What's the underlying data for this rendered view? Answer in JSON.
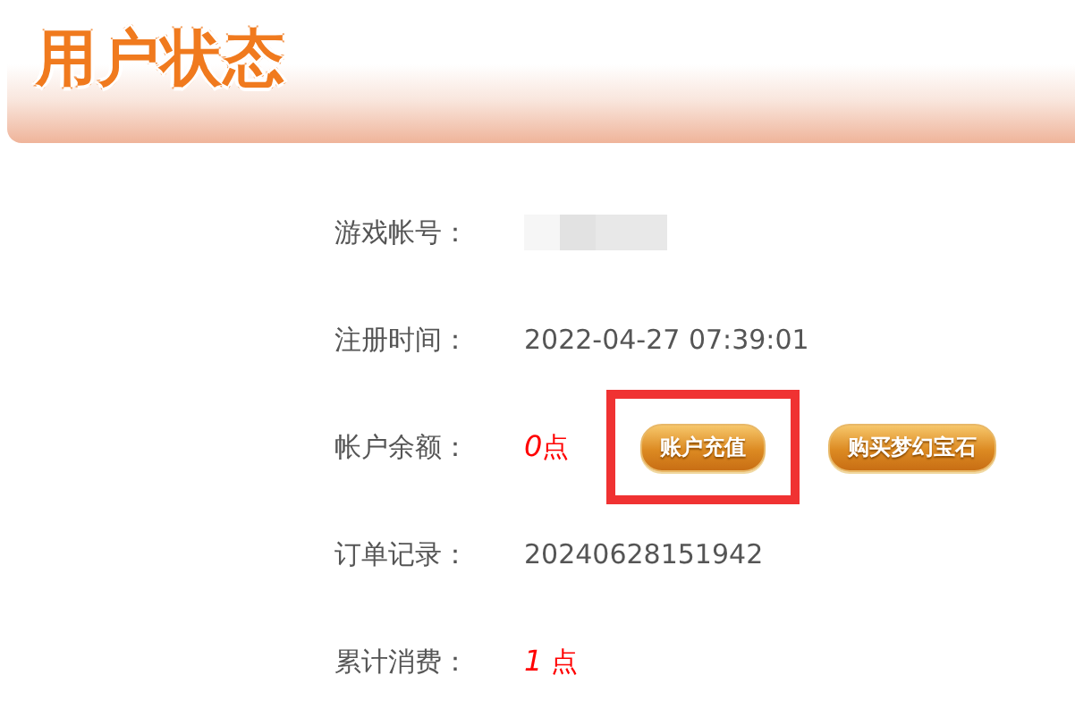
{
  "header": {
    "title": "用户状态"
  },
  "rows": [
    {
      "kind": "redacted",
      "label": "游戏帐号："
    },
    {
      "kind": "text",
      "label": "注册时间：",
      "value": "2022-04-27 07:39:01"
    },
    {
      "kind": "points",
      "label": "帐户余额：",
      "amount": "0",
      "unit": "点",
      "buttons": [
        {
          "label": "账户充值",
          "highlighted": true
        },
        {
          "label": "购买梦幻宝石",
          "highlighted": false
        }
      ]
    },
    {
      "kind": "text",
      "label": "订单记录：",
      "value": "20240628151942"
    },
    {
      "kind": "points",
      "label": "累计消费：",
      "amount": "1",
      "unit": " 点"
    }
  ]
}
